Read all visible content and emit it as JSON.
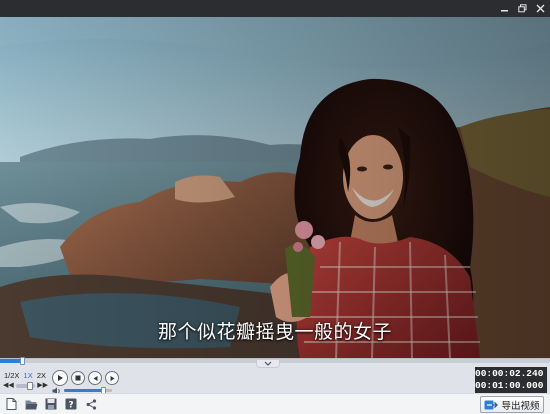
{
  "window": {
    "controls": [
      "minimize-icon",
      "restore-icon",
      "close-icon"
    ]
  },
  "video": {
    "subtitle": "那个似花瓣摇曳一般的女子"
  },
  "playback": {
    "progress_fraction": 0.04,
    "speed_options": [
      "1/2X",
      "1X",
      "2X"
    ],
    "active_speed": "1X",
    "speed_step_down": "◀◀",
    "speed_step_up": "▶▶",
    "volume_fraction": 0.82
  },
  "time": {
    "current": "00:00:02.240",
    "total": "00:01:00.000"
  },
  "toolbar": {
    "icons": [
      "new-file-icon",
      "open-folder-icon",
      "save-icon",
      "help-icon",
      "share-icon"
    ],
    "export_label": "导出视频"
  },
  "colors": {
    "accent": "#2d7fd3",
    "titlebar": "#2b2d31"
  }
}
